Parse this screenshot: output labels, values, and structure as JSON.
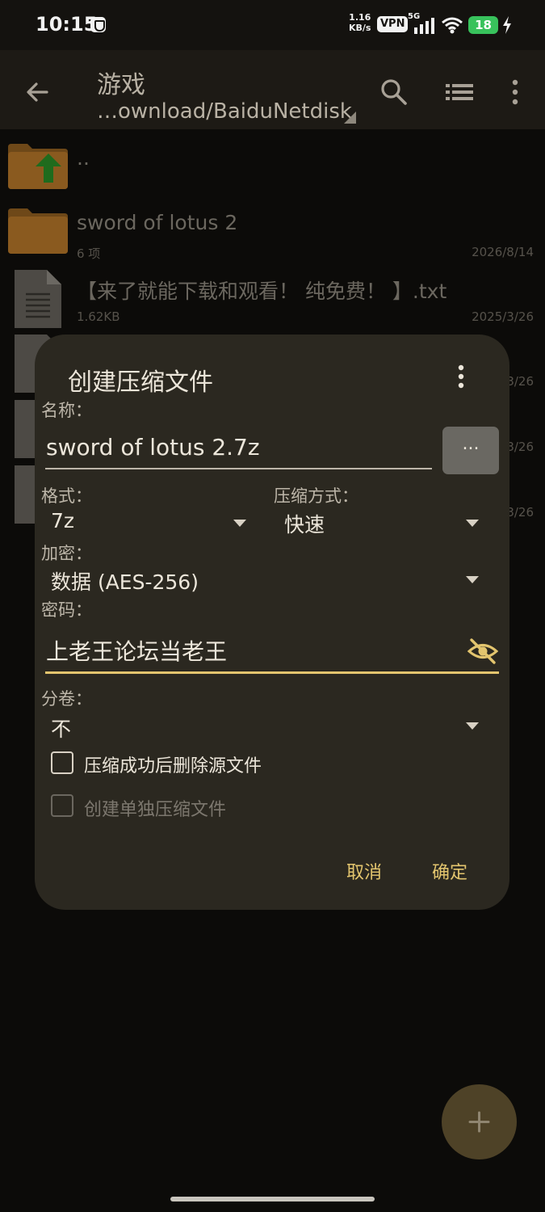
{
  "status_bar": {
    "time": "10:15",
    "speed_value": "1.16",
    "speed_unit": "KB/s",
    "vpn": "VPN",
    "signal": "5G",
    "battery": "18",
    "icons": [
      "shield-icon",
      "signal-bars-icon",
      "wifi-icon",
      "battery-icon",
      "charging-bolt-icon"
    ]
  },
  "app_bar": {
    "title": "游戏",
    "path": "…ownload/BaiduNetdisk",
    "icons": [
      "back-arrow-icon",
      "search-icon",
      "list-view-icon",
      "more-vert-icon"
    ]
  },
  "file_list": [
    {
      "name": "..",
      "meta": "",
      "date": "",
      "type": "parent-folder"
    },
    {
      "name": "sword of lotus 2",
      "meta": "6 项",
      "date": "2026/8/14",
      "type": "folder"
    },
    {
      "name": "【来了就能下载和观看！ 纯免费！ 】.txt",
      "meta": "1.62KB",
      "date": "2025/3/26",
      "type": "document"
    },
    {
      "name": "",
      "meta": "",
      "date": "3/26",
      "type": "document"
    },
    {
      "name": "",
      "meta": "",
      "date": "3/26",
      "type": "document"
    },
    {
      "name": "",
      "meta": "",
      "date": "3/26",
      "type": "document"
    }
  ],
  "dialog": {
    "title": "创建压缩文件",
    "name_label": "名称：",
    "name_value": "sword of lotus 2.7z",
    "browse_label": "...",
    "format_label": "格式：",
    "format_value": "7z",
    "method_label": "压缩方式：",
    "method_value": "快速",
    "encryption_label": "加密：",
    "encryption_value": "数据 (AES-256)",
    "password_label": "密码：",
    "password_value": "上老王论坛当老王",
    "split_label": "分卷：",
    "split_value": "不",
    "delete_source_label": "压缩成功后删除源文件",
    "delete_source_checked": false,
    "separate_archives_label": "创建单独压缩文件",
    "separate_archives_checked": false,
    "separate_archives_enabled": false,
    "cancel_label": "取消",
    "ok_label": "确定"
  },
  "colors": {
    "accent": "#e3c56e",
    "dialog_bg": "#2b2820",
    "app_bar_bg": "#1d1a15",
    "folder": "#8a5a1f",
    "battery": "#38c25c"
  }
}
